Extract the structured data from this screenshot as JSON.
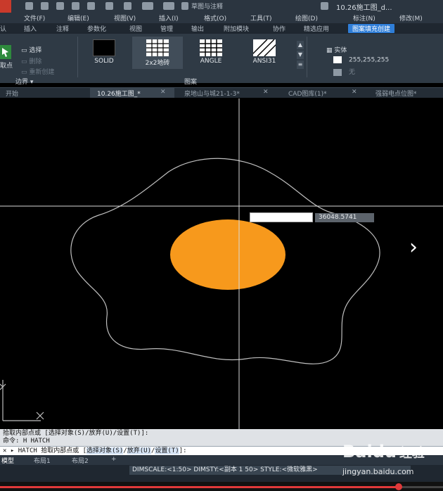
{
  "titlebar": {
    "workspace": "草图与注释",
    "document_title": "10.26施工图_d..."
  },
  "menubar": {
    "items": [
      "文件(F)",
      "编辑(E)",
      "视图(V)",
      "插入(I)",
      "格式(O)",
      "工具(T)",
      "绘图(D)",
      "标注(N)",
      "修改(M)"
    ]
  },
  "ribbon_tabs": {
    "items": [
      "认",
      "插入",
      "注释",
      "参数化",
      "视图",
      "管理",
      "输出",
      "附加模块",
      "协作",
      "精选应用"
    ],
    "active": "图案填充创建"
  },
  "ribbon": {
    "boundary": {
      "pick_points": "取点",
      "select": "选择",
      "remove": "删除",
      "recreate": "重新创建",
      "panel_label": "边界"
    },
    "patterns": {
      "items": [
        "SOLID",
        "2x2地砖",
        "ANGLE",
        "ANSI31"
      ],
      "panel_label": "图案"
    },
    "properties": {
      "pattern_type": "实体",
      "color": "255,255,255",
      "background": "无"
    }
  },
  "file_tabs": {
    "items": [
      "开始",
      "10.26施工图_*",
      "泉地山与城21-1-3*",
      "CAD图库(1)*",
      "强弱电点位图*"
    ]
  },
  "viewport": {
    "dynamic_readout": "36048.5741",
    "fill_color": "#f7991c"
  },
  "command": {
    "history_line1": "拾取内部点或 [选择对象(S)/放弃(U)/设置(T)]:",
    "history_line2": "命令: H HATCH",
    "current_prefix": "HATCH 拾取内部点或 [",
    "current_s": "选择对象(S)",
    "current_u": "放弃(U)",
    "current_t": "设置(T)",
    "current_suffix": "]:"
  },
  "layout_tabs": {
    "items": [
      "模型",
      "布局1",
      "布局2",
      "+"
    ]
  },
  "status": {
    "system_vars": "DIMSCALE:<1:50> DIMSTY:<副本 1 50> STYLE:<微软雅黑>"
  },
  "watermark": {
    "brand": "Baidu",
    "sub": "经验",
    "url": "jingyan.baidu.com"
  },
  "video": {
    "progress": 0.9
  },
  "icons": {
    "next": "chevron-right-icon",
    "ucs": "ucs-icon"
  }
}
